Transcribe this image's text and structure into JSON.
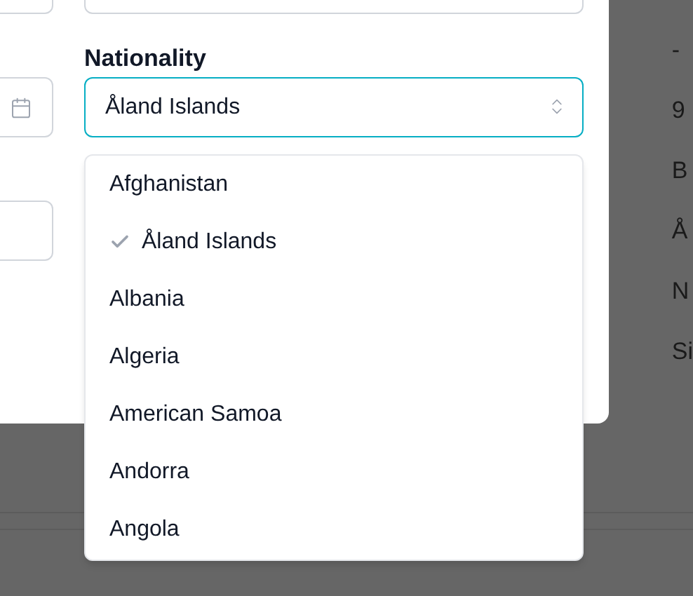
{
  "nationality": {
    "label": "Nationality",
    "value": "Åland Islands"
  },
  "options": [
    {
      "label": "Afghanistan",
      "selected": false
    },
    {
      "label": "Åland Islands",
      "selected": true
    },
    {
      "label": "Albania",
      "selected": false
    },
    {
      "label": "Algeria",
      "selected": false
    },
    {
      "label": "American Samoa",
      "selected": false
    },
    {
      "label": "Andorra",
      "selected": false
    },
    {
      "label": "Angola",
      "selected": false
    }
  ],
  "background_column": [
    "-",
    "9",
    "B",
    "Å",
    "N",
    "Si"
  ]
}
